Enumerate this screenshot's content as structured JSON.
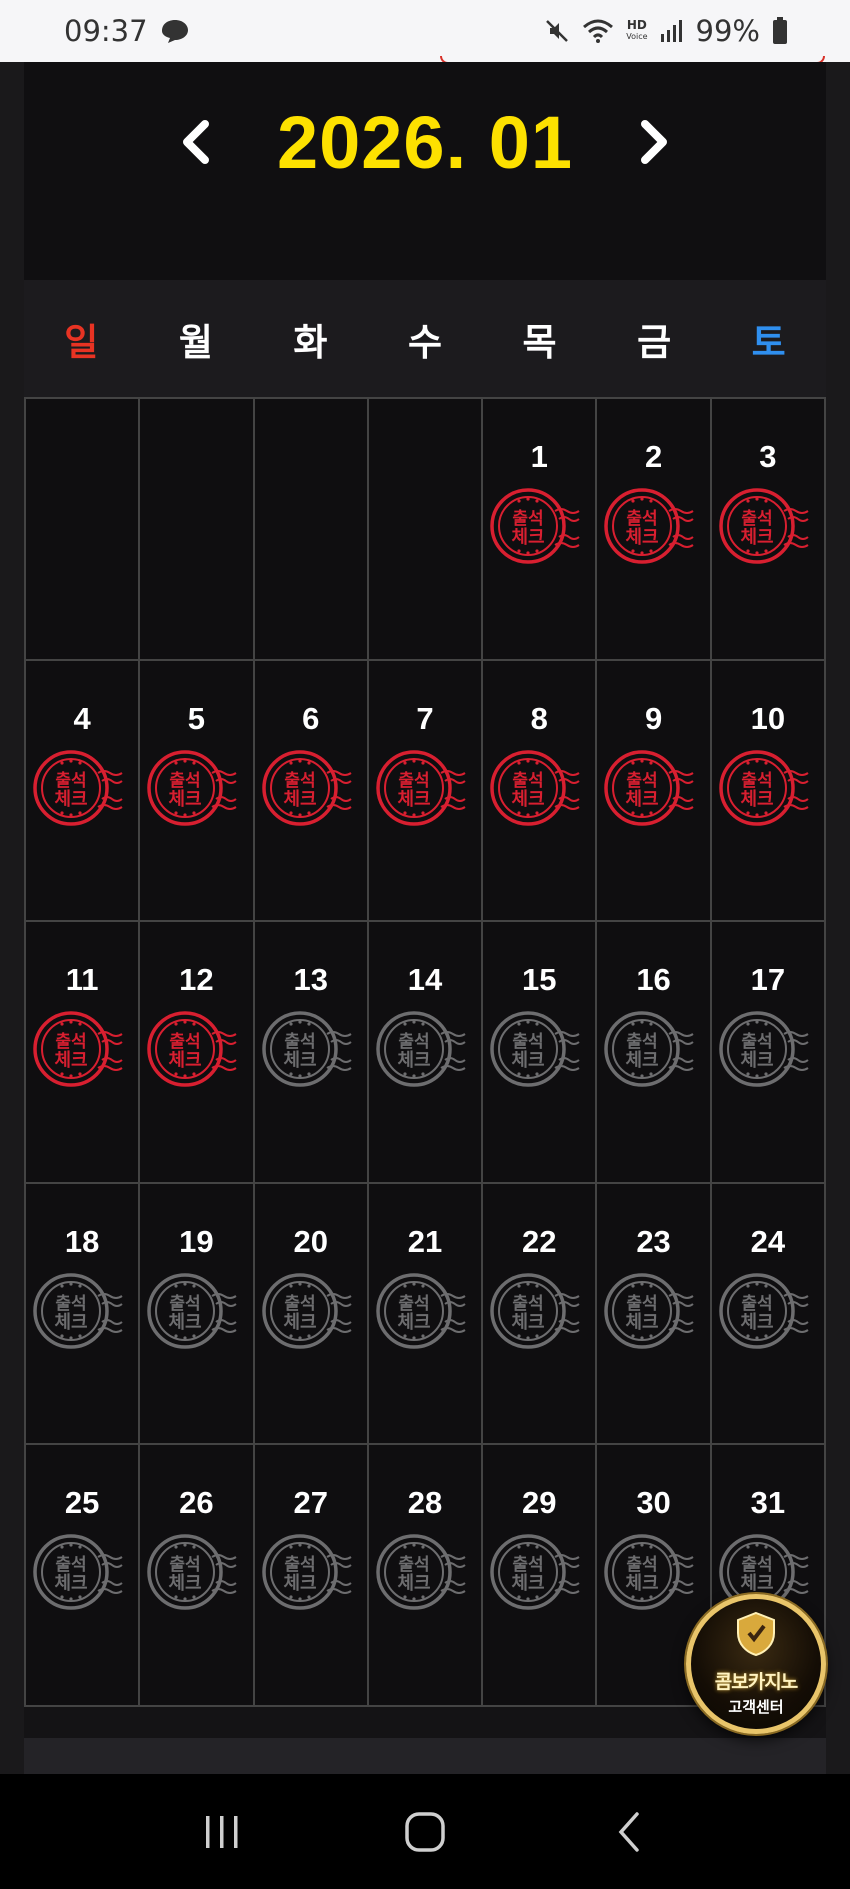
{
  "status_bar": {
    "time": "09:37",
    "battery": "99%",
    "hd_label": "HD",
    "voice_label": "Voice"
  },
  "calendar": {
    "month_title": "2026. 01",
    "prev_icon": "chevron-left-icon",
    "next_icon": "chevron-right-icon",
    "weekdays": [
      "일",
      "월",
      "화",
      "수",
      "목",
      "금",
      "토"
    ],
    "leading_blank_days": 4,
    "days": [
      "1",
      "2",
      "3",
      "4",
      "5",
      "6",
      "7",
      "8",
      "9",
      "10",
      "11",
      "12",
      "13",
      "14",
      "15",
      "16",
      "17",
      "18",
      "19",
      "20",
      "21",
      "22",
      "23",
      "24",
      "25",
      "26",
      "27",
      "28",
      "29",
      "30",
      "31"
    ],
    "checked_through_day": 12,
    "stamp_text_line1": "출석",
    "stamp_text_line2": "체크",
    "colors": {
      "title": "#fde100",
      "sunday": "#e83323",
      "saturday": "#2f8fef",
      "stamp_checked": "#d81f30",
      "stamp_unchecked": "#6d6d6f"
    }
  },
  "support_badge": {
    "line1": "콤보카지노",
    "line2": "고객센터",
    "icon": "shield-icon"
  },
  "nav_bar": {
    "recent_icon": "recent-apps-icon",
    "home_icon": "home-icon",
    "back_icon": "back-icon"
  }
}
